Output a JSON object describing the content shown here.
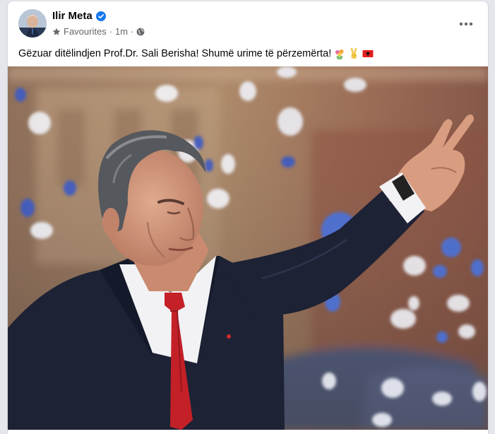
{
  "post": {
    "author": "Ilir Meta",
    "audience": "Favourites",
    "time": "1m",
    "separator": "·",
    "caption": "Gëzuar ditëlindjen Prof.Dr. Sali Berisha! Shumë urime të përzemërta!",
    "caption_emojis": [
      "flower-bouquet",
      "victory-hand",
      "albanian-flag"
    ],
    "photo_subject": "man in dark suit with red tie raising hand in victory sign, blue and white confetti"
  },
  "colors": {
    "verified": "#1877f2",
    "secondary_text": "#65676b",
    "card_bg": "#ffffff",
    "page_bg": "#e4e6eb"
  },
  "icons": {
    "verified": "verified-badge-icon",
    "audience": "star-icon",
    "privacy": "globe-icon",
    "more": "more-options-icon"
  }
}
